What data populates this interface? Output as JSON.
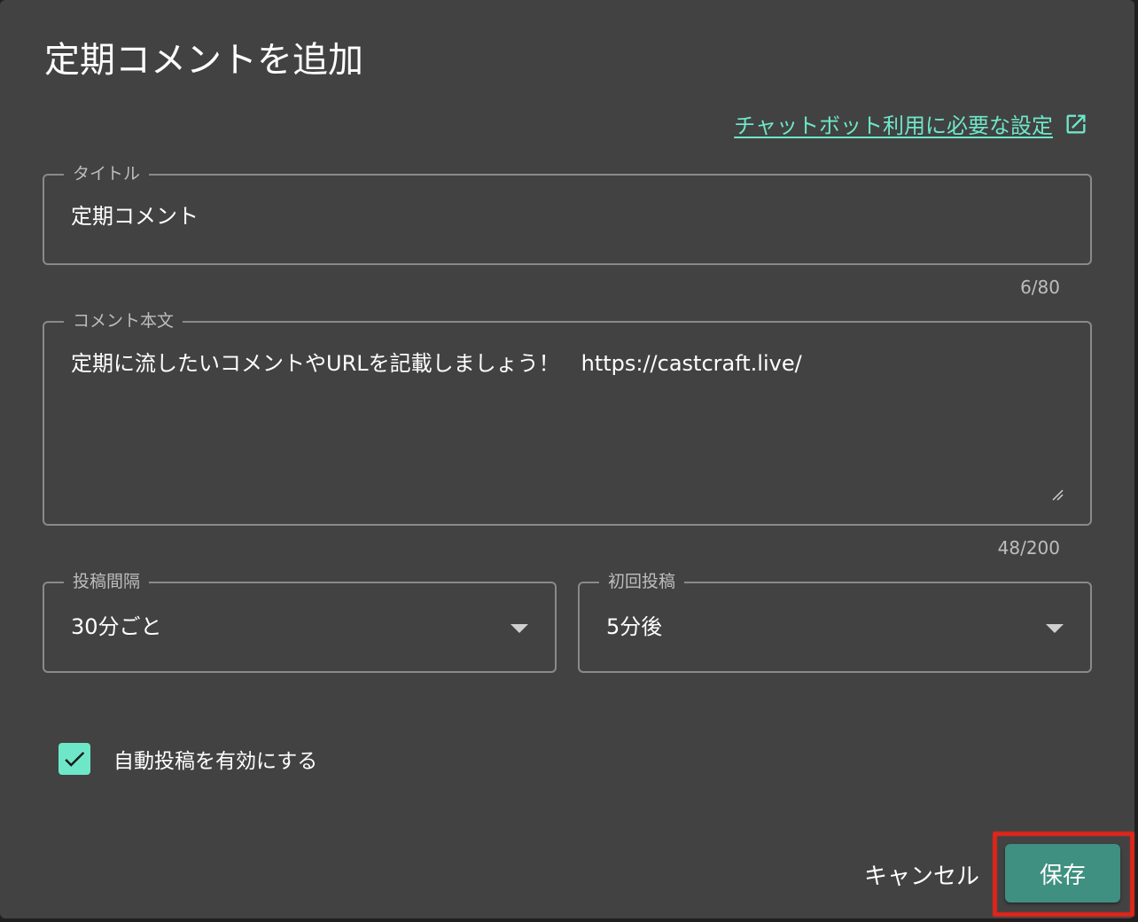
{
  "dialog": {
    "title": "定期コメントを追加",
    "help_link": "チャットボット利用に必要な設定"
  },
  "title_field": {
    "label": "タイトル",
    "value": "定期コメント",
    "counter": "6/80"
  },
  "body_field": {
    "label": "コメント本文",
    "value": "定期に流したいコメントやURLを記載しましょう！　https://castcraft.live/",
    "counter": "48/200"
  },
  "interval_select": {
    "label": "投稿間隔",
    "value": "30分ごと"
  },
  "first_post_select": {
    "label": "初回投稿",
    "value": "5分後"
  },
  "auto_post": {
    "label": "自動投稿を有効にする",
    "checked": true
  },
  "actions": {
    "cancel_label": "キャンセル",
    "save_label": "保存"
  },
  "colors": {
    "dialog_bg": "#424242",
    "accent": "#6ee7c8",
    "primary_button": "#3f9080",
    "highlight": "#e0251b"
  },
  "icons": {
    "help_link": "open-in-new-icon",
    "select": "triangle-down-icon",
    "checkbox": "check-icon"
  }
}
